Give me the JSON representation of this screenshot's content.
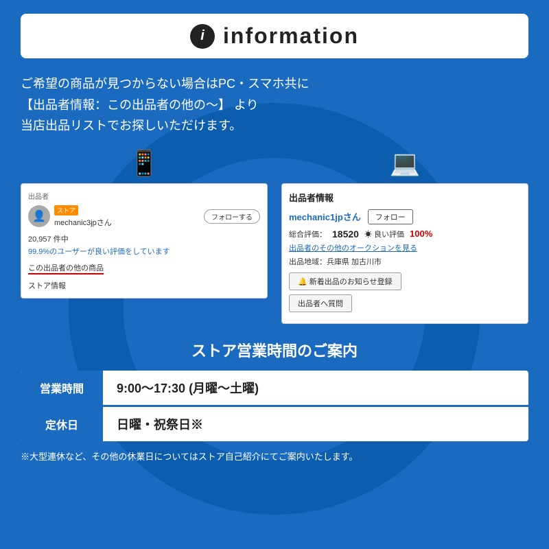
{
  "header": {
    "icon_label": "i",
    "title": "information"
  },
  "main_text": {
    "line1": "ご希望の商品が見つからない場合はPC・スマホ共に",
    "line2": "【出品者情報：この出品者の他の〜】 より",
    "line3": "当店出品リストでお探しいただけます。"
  },
  "left_screenshot": {
    "section_label": "出品者",
    "store_badge": "ストア",
    "seller_name": "mechanic3jpさん",
    "follow_btn": "フォローする",
    "review_count": "20,957 件中",
    "review_pct": "99.9%のユーザーが良い評価をしています",
    "other_items": "この出品者の他の商品",
    "store_info": "ストア情報"
  },
  "right_screenshot": {
    "section_label": "出品者情報",
    "seller_name": "mechanic1jpさん",
    "follow_btn": "フォロー",
    "rating_label": "総合評価：",
    "rating_count": "18520",
    "good_label": "☀ 良い評価",
    "good_pct": "100%",
    "auction_link": "出品者のその他のオークションを見る",
    "location_label": "出品地域：兵庫県 加古川市",
    "notify_btn": "🔔 新着出品のお知らせ登録",
    "question_btn": "出品者へ質問"
  },
  "hours_section": {
    "title": "ストア営業時間のご案内",
    "rows": [
      {
        "label": "営業時間",
        "value": "9:00〜17:30 (月曜〜土曜)"
      },
      {
        "label": "定休日",
        "value": "日曜・祝祭日※"
      }
    ],
    "footer": "※大型連休など、その他の休業日についてはストア自己紹介にてご案内いたします。"
  },
  "icons": {
    "smartphone": "📱",
    "computer": "💻"
  }
}
